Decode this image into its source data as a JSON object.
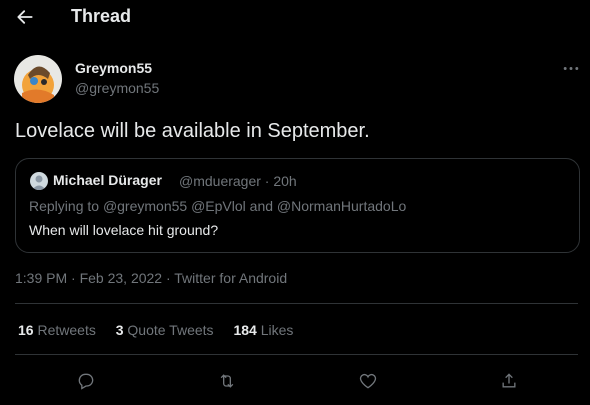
{
  "header": {
    "title": "Thread",
    "back_icon": "arrow-left-icon"
  },
  "tweet": {
    "author_name": "Greymon55",
    "author_handle": "@greymon55",
    "text": "Lovelace will be available in September.",
    "timestamp": "1:39 PM · Feb 23, 2022 · Twitter for Android",
    "more_icon": "more-horizontal-icon"
  },
  "quote": {
    "author_name": "Michael Dürager",
    "meta": "@mduerager · 20h",
    "reply_prefix": "Replying to",
    "reply_to": "@greymon55 @EpVlol",
    "reply_and": "and",
    "reply_last": "@NormanHurtadoLo",
    "text": "When will lovelace hit ground?"
  },
  "stats": {
    "retweets_count": "16",
    "retweets_label": "Retweets",
    "quotes_count": "3",
    "quotes_label": "Quote Tweets",
    "likes_count": "184",
    "likes_label": "Likes"
  },
  "actions": [
    "reply-icon",
    "retweet-icon",
    "like-icon",
    "share-icon"
  ],
  "colors": {
    "background": "#000000",
    "text": "#e7e9ea",
    "muted": "#71767b",
    "border": "#2f3336"
  }
}
